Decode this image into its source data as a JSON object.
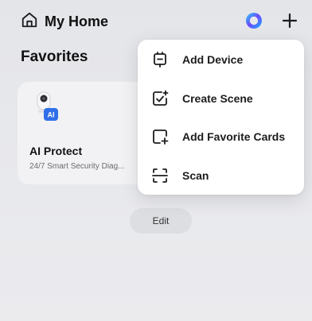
{
  "header": {
    "home_icon": "home-icon",
    "home_title": "My Home",
    "assistant_icon": "assistant-orb-icon",
    "add_icon": "plus-icon"
  },
  "favorites": {
    "title": "Favorites",
    "cards": [
      {
        "icon": "camera-ai-icon",
        "title": "AI Protect",
        "subtitle": "24/7 Smart Security Diag..."
      }
    ],
    "edit_label": "Edit"
  },
  "add_menu": {
    "items": [
      {
        "icon": "add-device-icon",
        "label": "Add Device"
      },
      {
        "icon": "create-scene-icon",
        "label": "Create Scene"
      },
      {
        "icon": "add-favorite-cards-icon",
        "label": "Add Favorite Cards"
      },
      {
        "icon": "scan-icon",
        "label": "Scan"
      }
    ]
  }
}
